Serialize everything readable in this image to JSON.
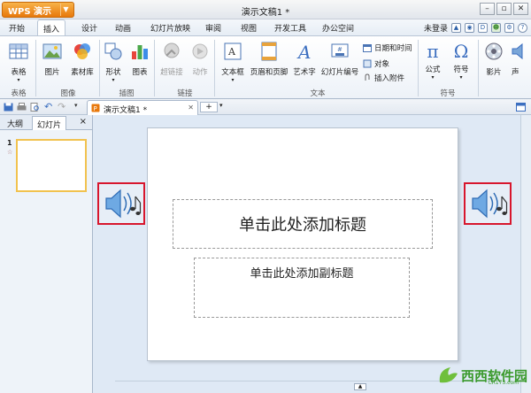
{
  "app": {
    "button_label": "WPS 演示",
    "doc_title": "演示文稿1 *"
  },
  "menu": {
    "tabs": [
      "开始",
      "插入",
      "设计",
      "动画",
      "幻灯片放映",
      "审阅",
      "视图",
      "开发工具",
      "办公空间"
    ],
    "active_tab": "插入",
    "login_label": "未登录"
  },
  "ribbon": {
    "items": {
      "table": "表格",
      "picture": "图片",
      "material": "素材库",
      "shape": "形状",
      "chart": "图表",
      "hyperlink": "超链接",
      "action": "动作",
      "textbox": "文本框",
      "header_footer": "页眉和页脚",
      "wordart": "艺术字",
      "slide_number": "幻灯片编号",
      "datetime": "日期和时间",
      "object": "对象",
      "attachment": "插入附件",
      "formula": "公式",
      "symbol": "符号",
      "movie": "影片",
      "sound": "声"
    },
    "groups": {
      "table": "表格",
      "image": "图像",
      "illustration": "插图",
      "link": "链接",
      "text": "文本",
      "symbol": "符号"
    }
  },
  "doc_tab": {
    "label": "演示文稿1 *",
    "add_label": "+"
  },
  "side_panel": {
    "tabs": [
      "大纲",
      "幻灯片"
    ],
    "active_tab": "幻灯片",
    "close": "×",
    "thumbnail_number": "1",
    "thumbnail_marker": "☆"
  },
  "slide": {
    "title_placeholder": "单击此处添加标题",
    "subtitle_placeholder": "单击此处添加副标题"
  },
  "watermark": {
    "text": "西西软件园",
    "sub": "CR173.com"
  },
  "colors": {
    "wps_orange": "#e8780b",
    "highlight_red": "#d8162d",
    "watermark_green": "#3a9a2c"
  }
}
